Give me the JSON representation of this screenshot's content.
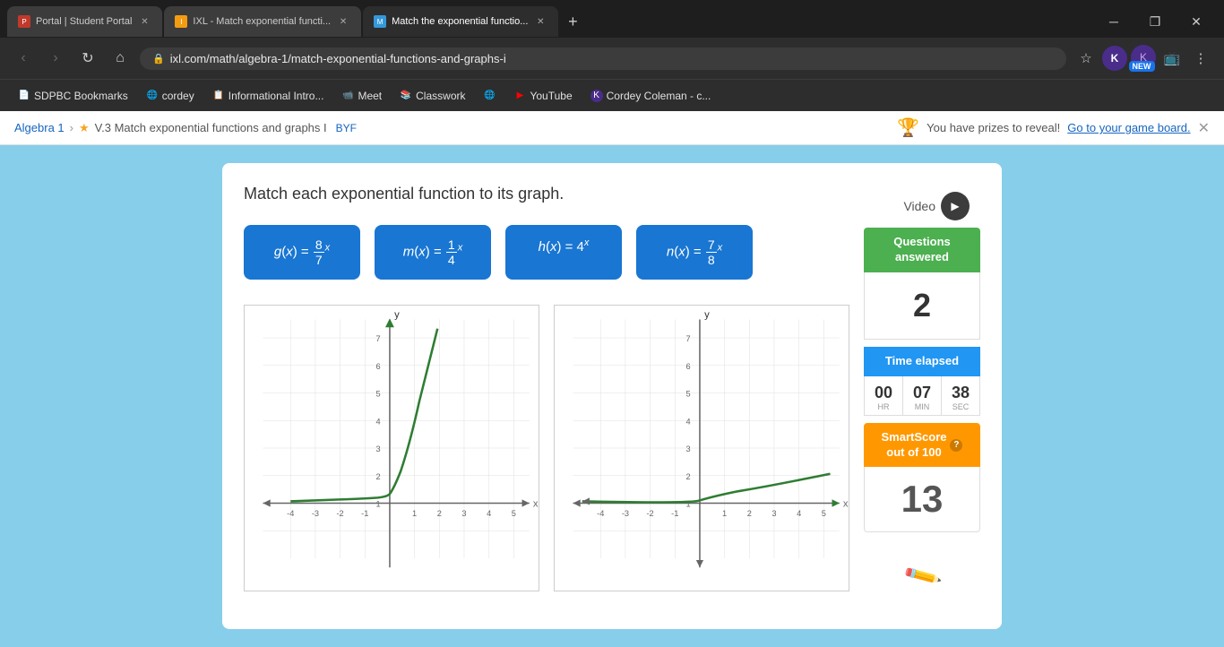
{
  "browser": {
    "tabs": [
      {
        "id": "t1",
        "title": "Portal | Student Portal",
        "favicon_color": "#c0392b",
        "active": false
      },
      {
        "id": "t2",
        "title": "IXL - Match exponential functi...",
        "favicon_color": "#f39c12",
        "active": false
      },
      {
        "id": "t3",
        "title": "Match the exponential functio...",
        "favicon_color": "#3498db",
        "active": true
      }
    ],
    "url": "ixl.com/math/algebra-1/match-exponential-functions-and-graphs-i",
    "profile_letter": "K"
  },
  "bookmarks": [
    {
      "label": "SDPBC Bookmarks",
      "icon": "📄"
    },
    {
      "label": "cordey",
      "icon": "🌐"
    },
    {
      "label": "Informational Intro...",
      "icon": "📋"
    },
    {
      "label": "Meet",
      "icon": "📹"
    },
    {
      "label": "Classwork",
      "icon": "📚"
    },
    {
      "label": "",
      "icon": "🌐"
    },
    {
      "label": "YouTube",
      "icon": "▶"
    },
    {
      "label": "Cordey Coleman - c...",
      "icon": "K"
    }
  ],
  "notification": {
    "breadcrumb_link": "Algebra 1",
    "breadcrumb_sep": "›",
    "starred": true,
    "lesson": "V.3 Match exponential functions and graphs I",
    "byf": "BYF",
    "prize_text": "You have prizes to reveal!",
    "prize_link": "Go to your game board."
  },
  "page": {
    "question": "Match each exponential function to its graph.",
    "video_label": "Video",
    "functions": [
      {
        "id": "g",
        "display": "g(x) = (8/7)^x"
      },
      {
        "id": "m",
        "display": "m(x) = (1/4)^x"
      },
      {
        "id": "h",
        "display": "h(x) = 4^x"
      },
      {
        "id": "n",
        "display": "n(x) = (7/8)^x"
      }
    ]
  },
  "sidebar": {
    "questions_answered_label": "Questions answered",
    "questions_count": "2",
    "time_elapsed_label": "Time elapsed",
    "time": {
      "hr": "00",
      "min": "07",
      "sec": "38",
      "hr_label": "HR",
      "min_label": "MIN",
      "sec_label": "SEC"
    },
    "smart_score_label": "SmartScore",
    "smart_score_sublabel": "out of 100",
    "smart_score_val": "13"
  },
  "colors": {
    "function_card_bg": "#1976d2",
    "questions_answered_bg": "#4caf50",
    "time_elapsed_bg": "#2196f3",
    "smart_score_bg": "#ff9800",
    "graph_line": "#2e7d32",
    "axis_color": "#666",
    "grid_color": "#e0e0e0"
  }
}
